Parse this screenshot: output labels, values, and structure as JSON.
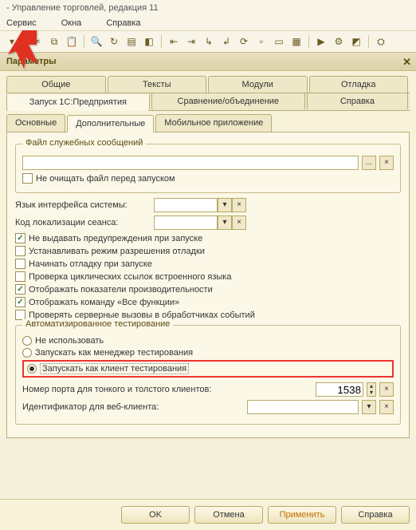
{
  "window_title": "- Управление торговлей, редакция 11",
  "menu": {
    "service": "Сервис",
    "windows": "Окна",
    "help": "Справка"
  },
  "panel_title": "Параметры",
  "tabs_top": {
    "general": "Общие",
    "texts": "Тексты",
    "modules": "Модули",
    "debug": "Отладка"
  },
  "tabs_mid": {
    "launch": "Запуск 1С:Предприятия",
    "compare": "Сравнение/объединение",
    "help": "Справка"
  },
  "tabs_sub": {
    "main": "Основные",
    "additional": "Дополнительные",
    "mobile": "Мобильное приложение"
  },
  "group_service_files": "Файл служебных сообщений",
  "dont_clear_file": "Не очищать файл перед запуском",
  "lang_label": "Язык интерфейса системы:",
  "locale_label": "Код локализации сеанса:",
  "chk_no_warnings": "Не выдавать предупреждения при запуске",
  "chk_debug_perm": "Устанавливать режим разрешения отладки",
  "chk_start_debug": "Начинать отладку при запуске",
  "chk_cyclic": "Проверка циклических ссылок встроенного языка",
  "chk_perf": "Отображать показатели производительности",
  "chk_all_func": "Отображать команду «Все функции»",
  "chk_server_calls": "Проверять серверные вызовы в обработчиках событий",
  "group_auto_test": "Автоматизированное тестирование",
  "radio_none": "Не использовать",
  "radio_manager": "Запускать как менеджер тестирования",
  "radio_client": "Запускать как клиент тестирования",
  "port_label": "Номер порта для тонкого и толстого клиентов:",
  "port_value": "1538",
  "webid_label": "Идентификатор для веб-клиента:",
  "buttons": {
    "ok": "OK",
    "cancel": "Отмена",
    "apply": "Применить",
    "help": "Справка"
  },
  "ellipsis": "...",
  "dd": "▾",
  "clr": "×"
}
